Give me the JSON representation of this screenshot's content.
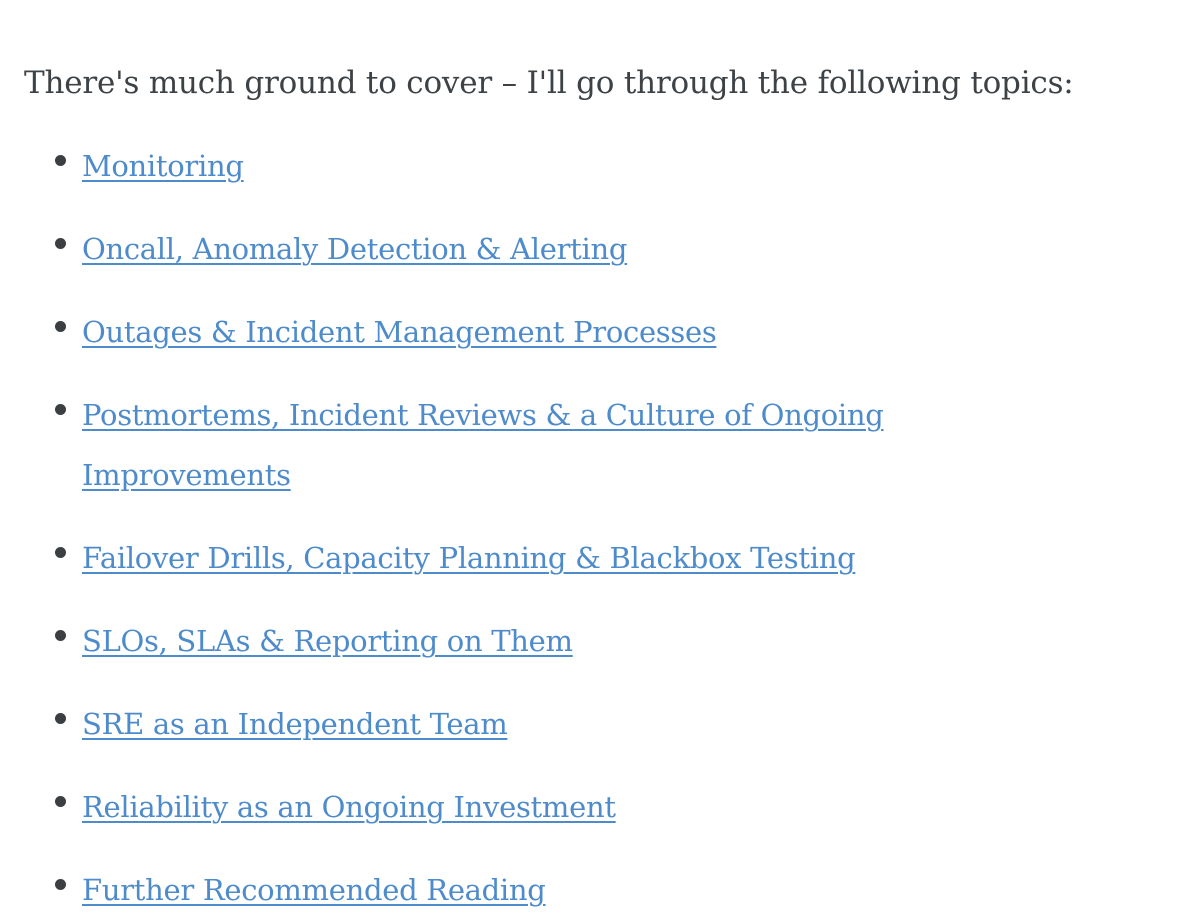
{
  "document": {
    "background_color": "#ffffff",
    "text_color": "#3d4246",
    "link_color": "#4e8bcb",
    "bullet_color": "#3b3f42",
    "intro_paragraph": "There's much ground to cover – I'll go through the following topics:",
    "topics": [
      {
        "label": "Monitoring",
        "wrapped": false
      },
      {
        "label": "Oncall, Anomaly Detection & Alerting",
        "wrapped": false
      },
      {
        "label": "Outages & Incident Management Processes",
        "wrapped": false
      },
      {
        "label": "Postmortems, Incident Reviews & a Culture of Ongoing Improvements",
        "wrapped": true
      },
      {
        "label": "Failover Drills, Capacity Planning & Blackbox Testing",
        "wrapped": false
      },
      {
        "label": "SLOs, SLAs & Reporting on Them",
        "wrapped": false
      },
      {
        "label": "SRE as an Independent Team",
        "wrapped": false
      },
      {
        "label": "Reliability as an Ongoing Investment",
        "wrapped": false
      },
      {
        "label": "Further Recommended Reading",
        "wrapped": false
      }
    ]
  }
}
